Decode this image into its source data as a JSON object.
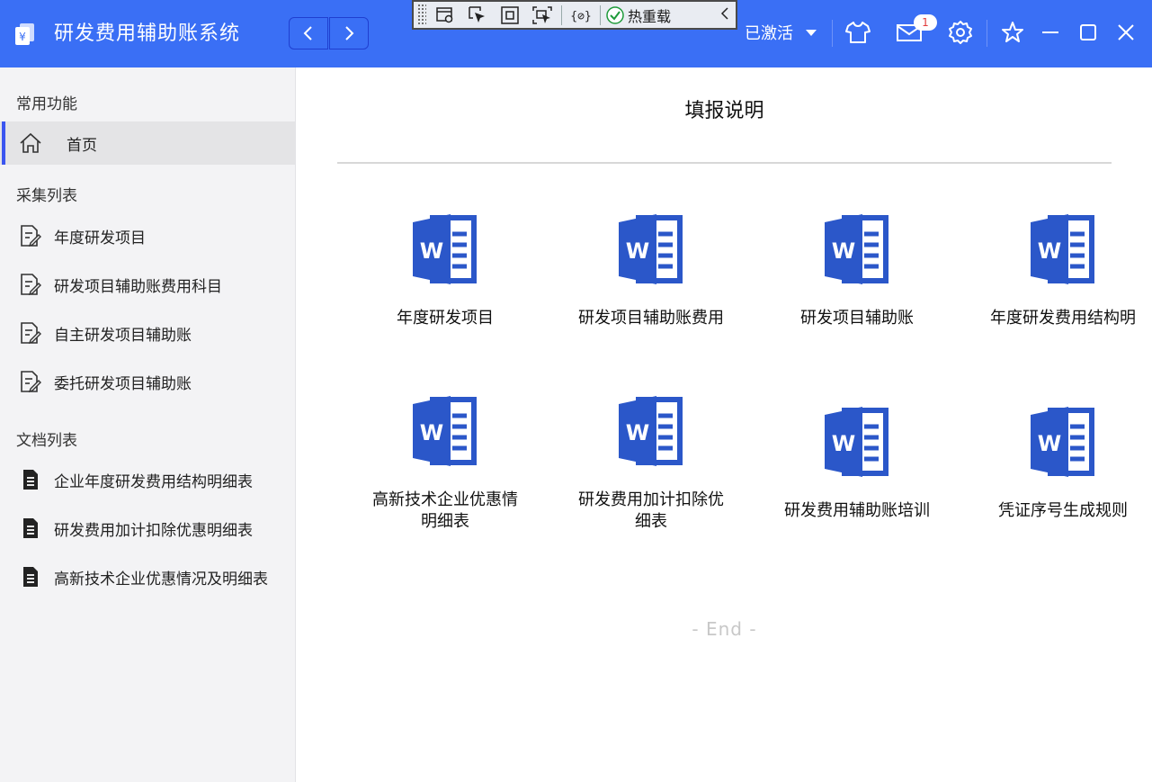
{
  "app": {
    "title": "研发费用辅助账系统"
  },
  "debug_toolbar": {
    "hot_reload_label": "热重载"
  },
  "header": {
    "activation_status": "已激活",
    "mail_badge_count": "1"
  },
  "sidebar": {
    "sections": [
      {
        "label": "常用功能",
        "items": [
          {
            "label": "首页",
            "icon": "home-icon",
            "active": true
          }
        ]
      },
      {
        "label": "采集列表",
        "items": [
          {
            "label": "年度研发项目",
            "icon": "edit-document-icon"
          },
          {
            "label": "研发项目辅助账费用科目",
            "icon": "edit-document-icon"
          },
          {
            "label": "自主研发项目辅助账",
            "icon": "edit-document-icon"
          },
          {
            "label": "委托研发项目辅助账",
            "icon": "edit-document-icon"
          }
        ]
      },
      {
        "label": "文档列表",
        "items": [
          {
            "label": "企业年度研发费用结构明细表",
            "icon": "document-icon"
          },
          {
            "label": "研发费用加计扣除优惠明细表",
            "icon": "document-icon"
          },
          {
            "label": "高新技术企业优惠情况及明细表",
            "icon": "document-icon"
          }
        ]
      }
    ]
  },
  "main": {
    "title": "填报说明",
    "documents": [
      {
        "label": "年度研发项目"
      },
      {
        "label": "研发项目辅助账费用"
      },
      {
        "label": "研发项目辅助账"
      },
      {
        "label": "年度研发费用结构明"
      },
      {
        "label_line1": "高新技术企业优惠情",
        "label_line2": "明细表"
      },
      {
        "label_line1": "研发费用加计扣除优",
        "label_line2": "细表"
      },
      {
        "label": "研发费用辅助账培训"
      },
      {
        "label": "凭证序号生成规则"
      }
    ],
    "end_text": "- End -"
  },
  "colors": {
    "header_bg": "#3a6ff5",
    "word_blue": "#2b57c9",
    "sidebar_bg": "#f3f3f5",
    "accent": "#3a55f0"
  }
}
